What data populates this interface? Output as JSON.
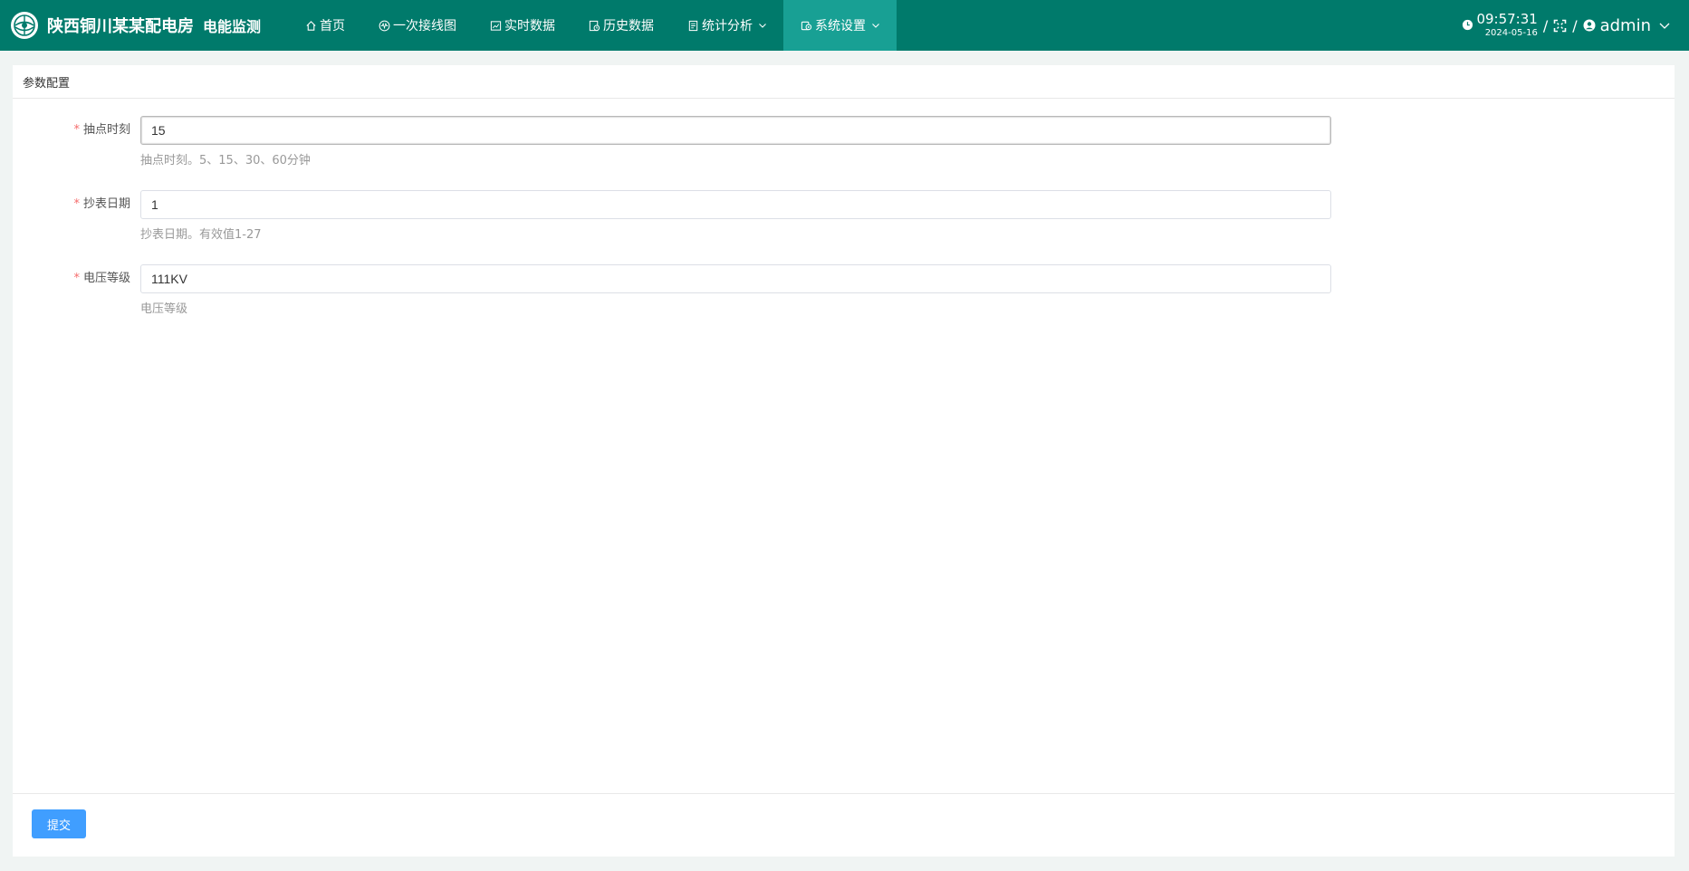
{
  "header": {
    "title": "陕西铜川某某配电房",
    "subtitle": "电能监测",
    "nav": [
      {
        "label": "首页",
        "icon": "home-icon"
      },
      {
        "label": "一次接线图",
        "icon": "waveform-icon"
      },
      {
        "label": "实时数据",
        "icon": "chart-icon"
      },
      {
        "label": "历史数据",
        "icon": "history-icon"
      },
      {
        "label": "统计分析",
        "icon": "document-icon",
        "dropdown": true
      },
      {
        "label": "系统设置",
        "icon": "settings-icon",
        "dropdown": true,
        "active": true
      }
    ],
    "time": "09:57:31",
    "date": "2024-05-16",
    "separator": "/",
    "user": "admin"
  },
  "card": {
    "title": "参数配置",
    "fields": [
      {
        "label": "抽点时刻",
        "value": "15",
        "help": "抽点时刻。5、15、30、60分钟",
        "required": true
      },
      {
        "label": "抄表日期",
        "value": "1",
        "help": "抄表日期。有效值1-27",
        "required": true
      },
      {
        "label": "电压等级",
        "value": "111KV",
        "help": "电压等级",
        "required": true
      }
    ],
    "required_mark": "*",
    "submit_label": "提交"
  },
  "colors": {
    "topbar": "#007a6b",
    "nav_active": "#18a094",
    "primary_button": "#409eff",
    "required": "#f56c6c"
  }
}
